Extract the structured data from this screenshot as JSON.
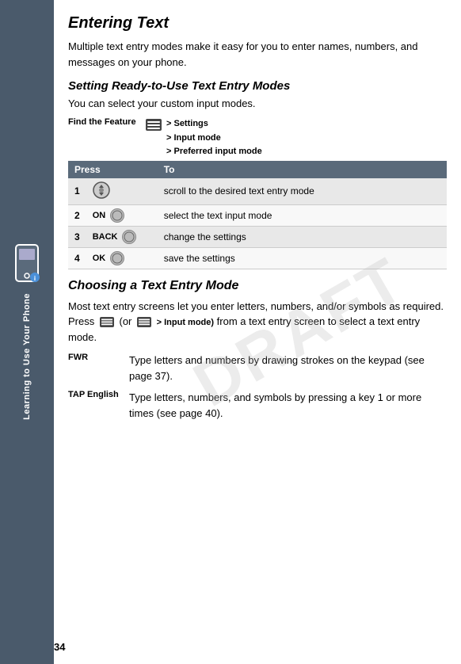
{
  "sidebar": {
    "label": "Learning to Use Your Phone"
  },
  "page": {
    "number": "34"
  },
  "watermark": "DRAFT",
  "main_title": "Entering Text",
  "intro": "Multiple text entry modes make it easy for you to enter names, numbers, and messages on your phone.",
  "section1_title": "Setting Ready-to-Use Text Entry Modes",
  "section1_intro": "You can select your custom input modes.",
  "find_feature": {
    "label": "Find the Feature",
    "path_icon": "menu",
    "path_items": [
      "> Settings",
      "> Input mode",
      "> Preferred input mode"
    ]
  },
  "table": {
    "headers": [
      "Press",
      "To"
    ],
    "rows": [
      {
        "num": "1",
        "key_icon": "scroll",
        "key_label": "",
        "description": "scroll to the desired text entry mode"
      },
      {
        "num": "2",
        "key_label": "ON",
        "key_icon": "circle",
        "description": "select the text input mode"
      },
      {
        "num": "3",
        "key_label": "BACK",
        "key_icon": "circle",
        "description": "change the settings"
      },
      {
        "num": "4",
        "key_label": "OK",
        "key_icon": "circle",
        "description": "save the settings"
      }
    ]
  },
  "section2_title": "Choosing a Text Entry Mode",
  "section2_body": "Most text entry screens let you enter letters, numbers, and/or symbols as required. Press",
  "section2_body2": "(or",
  "section2_body3": "> Input mode)",
  "section2_body4": "from a text entry screen to select a text entry mode.",
  "fwr": {
    "label": "FWR",
    "description": "Type letters and numbers by drawing strokes on the keypad (see page 37)."
  },
  "tap": {
    "label": "TAP English",
    "description": "Type letters, numbers, and symbols by pressing a key 1 or more times (see page 40)."
  }
}
